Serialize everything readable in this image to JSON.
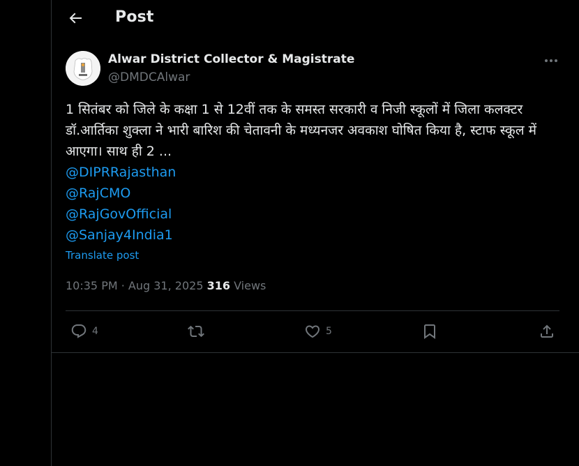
{
  "header": {
    "title": "Post"
  },
  "post": {
    "author_name": "Alwar District Collector & Magistrate",
    "handle": "@DMDCAlwar",
    "text": "1 सितंबर को जिले के कक्षा 1 से 12वीं तक के समस्त सरकारी व निजी स्कूलों में जिला कलक्टर डॉ.आर्तिका शुक्ला ने भारी बारिश की चेतावनी के मध्यनजर अवकाश घोषित किया है, स्टाफ स्कूल में आएगा। साथ ही 2 ...",
    "mentions": [
      "@DIPRRajasthan",
      "@RajCMO",
      "@RajGovOfficial",
      "@Sanjay4India1"
    ],
    "translate_label": "Translate post",
    "time": "10:35 PM",
    "date_sep": " · ",
    "date": "Aug 31, 2025",
    "views_count": "316",
    "views_label": " Views"
  },
  "actions": {
    "reply_count": "4",
    "like_count": "5"
  },
  "colors": {
    "accent": "#1d9bf0",
    "muted": "#71767b",
    "border": "#2f3336"
  },
  "icons": [
    "back-arrow-icon",
    "more-icon",
    "reply-icon",
    "repost-icon",
    "like-icon",
    "bookmark-icon",
    "share-icon"
  ]
}
